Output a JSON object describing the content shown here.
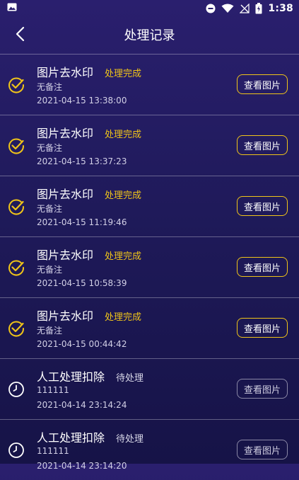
{
  "status_bar": {
    "time": "1:38"
  },
  "header": {
    "title": "处理记录"
  },
  "colors": {
    "accent": "#f0c419",
    "background": "#1f1a5a"
  },
  "records": [
    {
      "name": "图片去水印",
      "status": "处理完成",
      "note": "无备注",
      "time": "2021-04-15 13:38:00",
      "button": "查看图片",
      "state": "done",
      "icon": "check-circle-icon"
    },
    {
      "name": "图片去水印",
      "status": "处理完成",
      "note": "无备注",
      "time": "2021-04-15 13:37:23",
      "button": "查看图片",
      "state": "done",
      "icon": "check-circle-icon"
    },
    {
      "name": "图片去水印",
      "status": "处理完成",
      "note": "无备注",
      "time": "2021-04-15 11:19:46",
      "button": "查看图片",
      "state": "done",
      "icon": "check-circle-icon"
    },
    {
      "name": "图片去水印",
      "status": "处理完成",
      "note": "无备注",
      "time": "2021-04-15 10:58:39",
      "button": "查看图片",
      "state": "done",
      "icon": "check-circle-icon"
    },
    {
      "name": "图片去水印",
      "status": "处理完成",
      "note": "无备注",
      "time": "2021-04-15 00:44:42",
      "button": "查看图片",
      "state": "done",
      "icon": "check-circle-icon"
    },
    {
      "name": "人工处理扣除",
      "status": "待处理",
      "note": "111111",
      "time": "2021-04-14 23:14:24",
      "button": "查看图片",
      "state": "pending",
      "icon": "clock-icon"
    },
    {
      "name": "人工处理扣除",
      "status": "待处理",
      "note": "111111",
      "time": "2021-04-14 23:14:20",
      "button": "查看图片",
      "state": "pending",
      "icon": "clock-icon"
    }
  ]
}
